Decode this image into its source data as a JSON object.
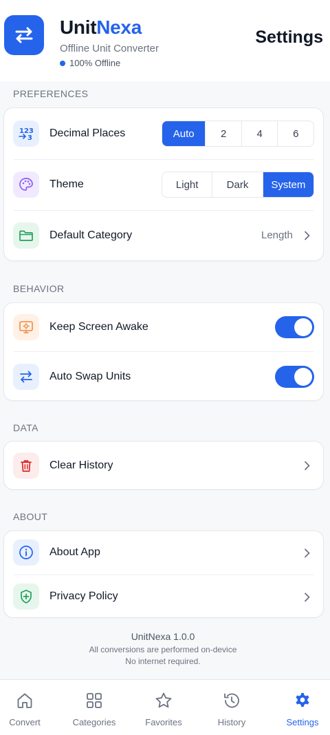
{
  "header": {
    "brand_part1": "Unit",
    "brand_part2": "Nexa",
    "subtitle": "Offline Unit Converter",
    "status": "100% Offline",
    "page_title": "Settings"
  },
  "sections": {
    "preferences": "PREFERENCES",
    "behavior": "BEHAVIOR",
    "data": "DATA",
    "about": "ABOUT"
  },
  "preferences": {
    "decimal_places": {
      "label": "Decimal Places",
      "icon_text": "123ⅹ3",
      "options": [
        "Auto",
        "2",
        "4",
        "6"
      ],
      "selected": "Auto"
    },
    "theme": {
      "label": "Theme",
      "options": [
        "Light",
        "Dark",
        "System"
      ],
      "selected": "System"
    },
    "default_category": {
      "label": "Default Category",
      "value": "Length"
    }
  },
  "behavior": {
    "keep_awake": {
      "label": "Keep Screen Awake",
      "enabled": true
    },
    "auto_swap": {
      "label": "Auto Swap Units",
      "enabled": true
    }
  },
  "data_section": {
    "clear_history": {
      "label": "Clear History"
    }
  },
  "about": {
    "about_app": {
      "label": "About App"
    },
    "privacy": {
      "label": "Privacy Policy"
    }
  },
  "footer": {
    "version": "UnitNexa 1.0.0",
    "line1": "All conversions are performed on-device",
    "line2": "No internet required."
  },
  "tabs": [
    {
      "label": "Convert",
      "icon": "home-icon",
      "active": false
    },
    {
      "label": "Categories",
      "icon": "grid-icon",
      "active": false
    },
    {
      "label": "Favorites",
      "icon": "star-icon",
      "active": false
    },
    {
      "label": "History",
      "icon": "history-icon",
      "active": false
    },
    {
      "label": "Settings",
      "icon": "gear-icon",
      "active": true
    }
  ],
  "colors": {
    "accent": "#2563eb",
    "decimal_icon_bg": "#e8f0fe",
    "theme_icon_bg": "#f1eafe",
    "category_icon_bg": "#e7f6ec",
    "awake_icon_bg": "#fff1e6",
    "swap_icon_bg": "#e8f0fe",
    "clear_icon_bg": "#fdecec",
    "about_icon_bg": "#e8f0fe",
    "privacy_icon_bg": "#e7f6ec"
  }
}
